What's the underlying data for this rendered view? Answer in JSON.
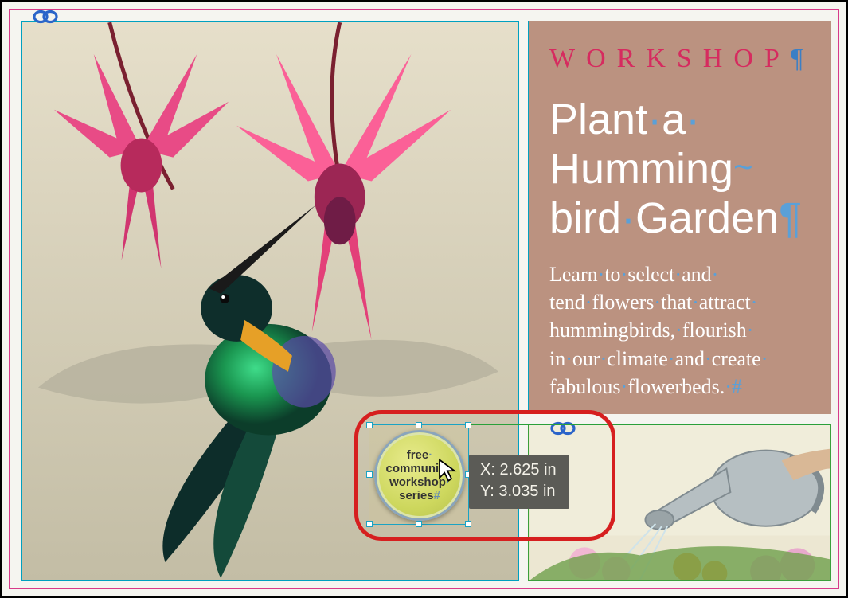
{
  "panel": {
    "eyebrow": "WORKSHOP",
    "headline_line1": "Plant",
    "headline_line1b": "a",
    "headline_line2": "Humming",
    "headline_line3a": "bird",
    "headline_line3b": "Garden",
    "body": "Learn to select and tend flowers that attract hummingbirds, flourish in our climate and create fabulous flowerbeds."
  },
  "badge": {
    "line1": "free",
    "line2": "community",
    "line3": "workshop",
    "line4": "series"
  },
  "coords": {
    "x_label": "X:",
    "x_value": "2.625 in",
    "y_label": "Y:",
    "y_value": "3.035 in"
  }
}
